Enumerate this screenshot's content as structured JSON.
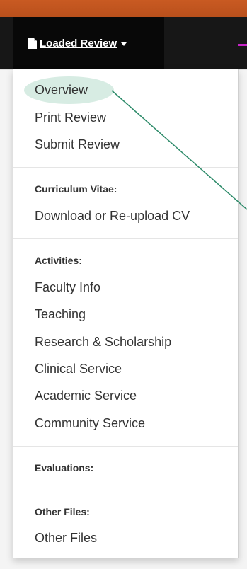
{
  "navbar": {
    "toggle_label": "Loaded Review"
  },
  "menu": {
    "top_items": [
      "Overview",
      "Print Review",
      "Submit Review"
    ],
    "curriculum_header": "Curriculum Vitae:",
    "curriculum_items": [
      "Download or Re-upload CV"
    ],
    "activities_header": "Activities:",
    "activities_items": [
      "Faculty Info",
      "Teaching",
      "Research & Scholarship",
      "Clinical Service",
      "Academic Service",
      "Community Service"
    ],
    "evaluations_header": "Evaluations:",
    "other_files_header": "Other Files:",
    "other_files_items": [
      "Other Files"
    ]
  },
  "colors": {
    "topbar": "#c95a22",
    "navbar": "#171717",
    "accent": "#c623c6",
    "highlight": "#d7ece3",
    "annotation_line": "#2e8b6a"
  }
}
